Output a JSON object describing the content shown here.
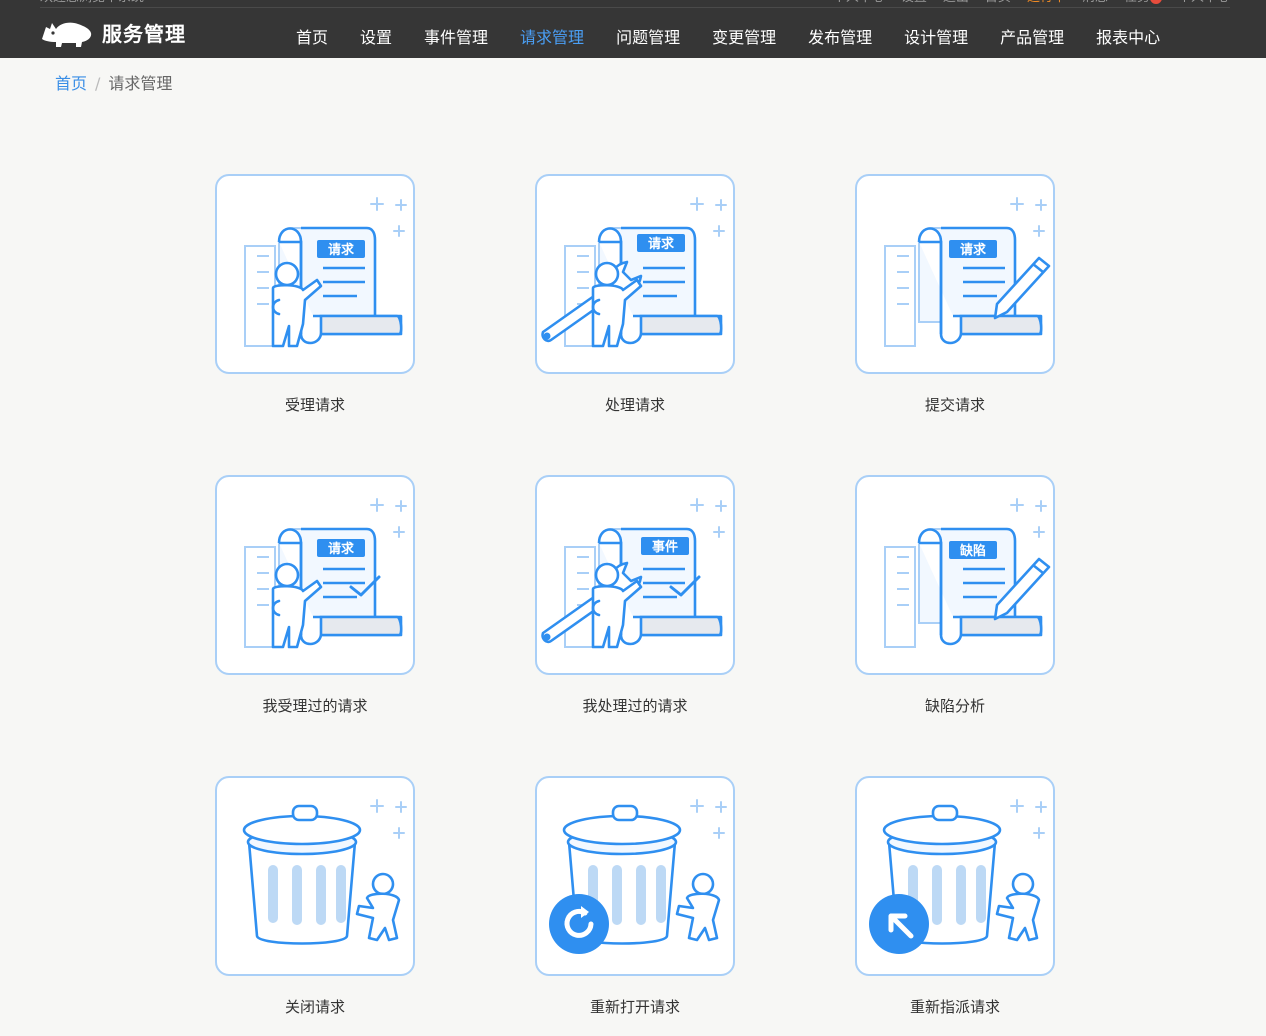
{
  "header": {
    "strip_left": "欢迎您浏览本系统",
    "strip_right": [
      "个人中心",
      "设置",
      "退出",
      "首页",
      "运行中",
      "消息",
      "任务",
      "个人中心"
    ],
    "brand": "服务管理",
    "nav": [
      "首页",
      "设置",
      "事件管理",
      "请求管理",
      "问题管理",
      "变更管理",
      "发布管理",
      "设计管理",
      "产品管理",
      "报表中心"
    ],
    "active_nav": "请求管理"
  },
  "breadcrumb": {
    "home": "首页",
    "current": "请求管理"
  },
  "tiles": [
    {
      "label": "受理请求",
      "icon": "document-person-icon",
      "badge": "请求"
    },
    {
      "label": "处理请求",
      "icon": "document-wrench-icon",
      "badge": "请求"
    },
    {
      "label": "提交请求",
      "icon": "document-pen-icon",
      "badge": "请求"
    },
    {
      "label": "我受理过的请求",
      "icon": "document-person-check-icon",
      "badge": "请求"
    },
    {
      "label": "我处理过的请求",
      "icon": "document-wrench-check-icon",
      "badge": "事件"
    },
    {
      "label": "缺陷分析",
      "icon": "document-pen-icon",
      "badge": "缺陷"
    },
    {
      "label": "关闭请求",
      "icon": "trash-person-icon"
    },
    {
      "label": "重新打开请求",
      "icon": "trash-reopen-icon"
    },
    {
      "label": "重新指派请求",
      "icon": "trash-reassign-icon"
    }
  ]
}
